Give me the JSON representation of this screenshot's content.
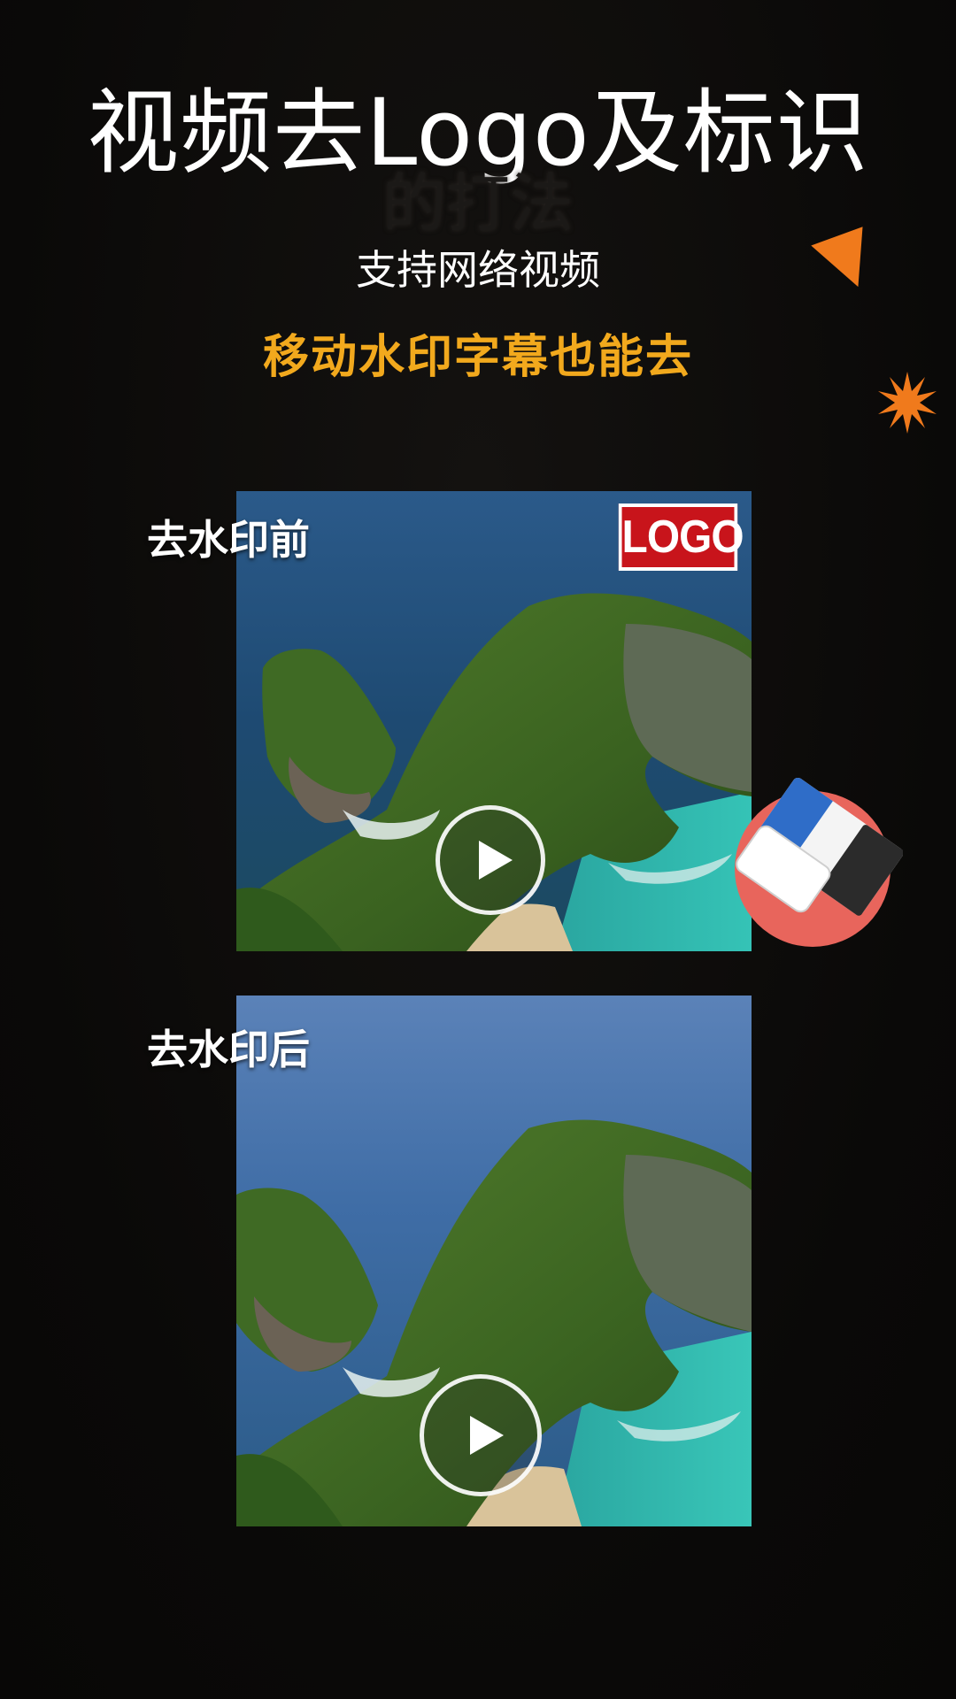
{
  "header": {
    "title": "视频去Logo及标识",
    "title_ghost": "的打法",
    "subtitle": "支持网络视频",
    "tagline": "移动水印字幕也能去"
  },
  "before": {
    "label": "去水印前",
    "logo_text": "LOGO",
    "play_icon": "play-icon"
  },
  "after": {
    "label": "去水印后",
    "play_icon": "play-icon"
  },
  "decorations": {
    "triangle_color": "#f07a1c",
    "star_color": "#f07a1c",
    "eraser_icon": "eraser-icon",
    "eraser_bg": "#e8655c"
  }
}
